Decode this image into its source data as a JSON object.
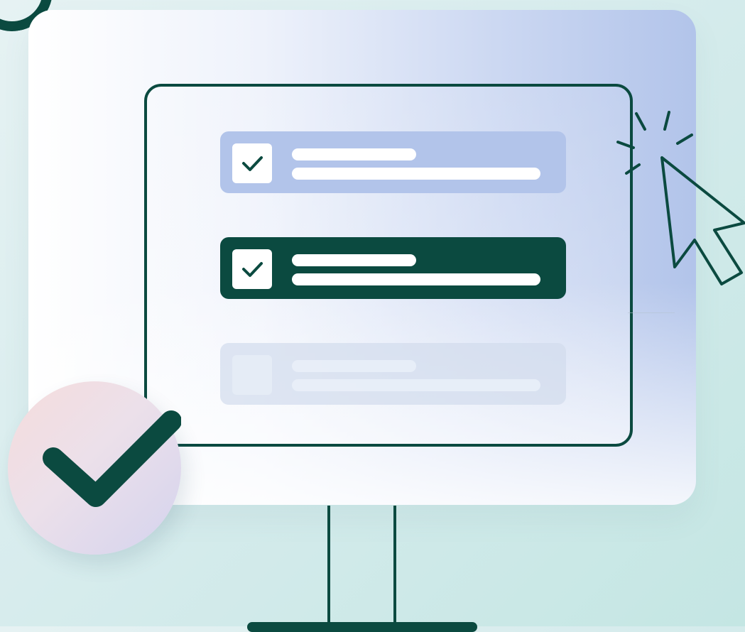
{
  "illustration": {
    "checklist": {
      "items": [
        {
          "state": "checked",
          "style": "highlighted",
          "color": "#b2c4ea"
        },
        {
          "state": "checked",
          "style": "selected",
          "color": "#0b4a40"
        },
        {
          "state": "unchecked",
          "style": "faded",
          "color": "#d2dcec"
        }
      ]
    },
    "icons": {
      "cursor": "mouse-pointer-click-icon",
      "badge": "check-circle-icon"
    },
    "colors": {
      "primary": "#0b4a40",
      "accent": "#b2c4ea",
      "background": "#d7eced"
    }
  }
}
